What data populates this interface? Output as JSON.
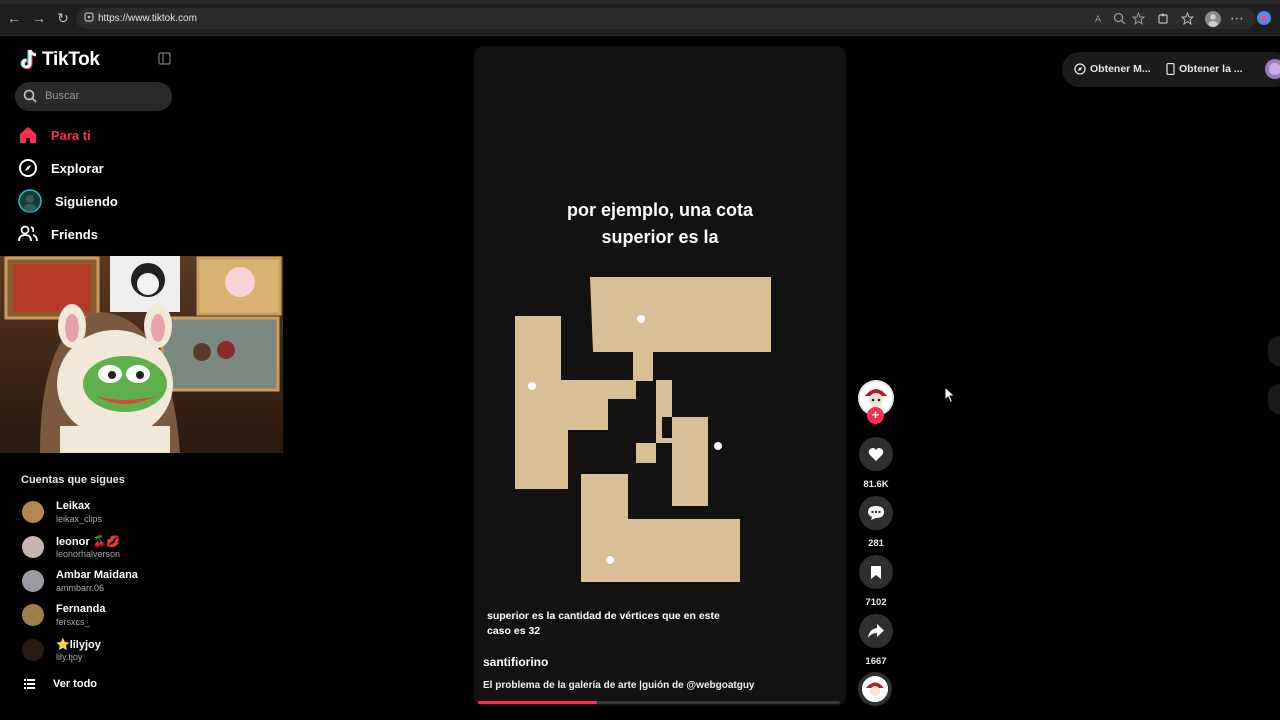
{
  "browser": {
    "url": "https://www.tiktok.com"
  },
  "sidebar": {
    "logo": "TikTok",
    "search_placeholder": "Buscar",
    "nav": [
      {
        "label": "Para ti",
        "icon": "home-icon",
        "active": true
      },
      {
        "label": "Explorar",
        "icon": "compass-icon"
      },
      {
        "label": "Siguiendo",
        "icon": "following-avatar-icon"
      },
      {
        "label": "Friends",
        "icon": "friends-icon"
      }
    ],
    "following_header": "Cuentas que sigues",
    "accounts": [
      {
        "name": "Leikax",
        "handle": "leikax_clips"
      },
      {
        "name": "leonor 🍒💋",
        "handle": "leonorhalverson"
      },
      {
        "name": "Ambar Maidana",
        "handle": "ammbarr.06"
      },
      {
        "name": "Fernanda",
        "handle": "fersxcs_"
      },
      {
        "name": "⭐lilyjoy",
        "handle": "lily.tjoy"
      }
    ],
    "see_all": "Ver todo"
  },
  "video": {
    "caption": "por ejemplo, una cota superior es la",
    "subtitle": "superior es la cantidad de vértices que en este caso es 32",
    "author": "santifiorino",
    "description": "El problema de la galería de arte |guión de @webgoatguy",
    "progress": 0.33
  },
  "actions": {
    "likes": "81.6K",
    "comments": "281",
    "saves": "7102",
    "shares": "1667"
  },
  "topright": {
    "item1": "Obtener M...",
    "item2": "Obtener la ..."
  },
  "colors": {
    "accent": "#fe2c55",
    "polygon": "#d9bf96"
  }
}
